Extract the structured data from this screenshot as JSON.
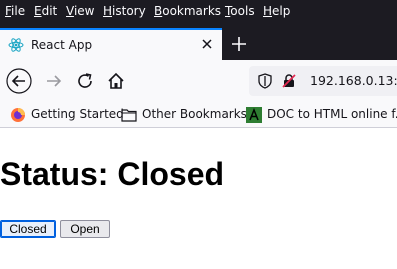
{
  "menu": [
    "File",
    "Edit",
    "View",
    "History",
    "Bookmarks",
    "Tools",
    "Help"
  ],
  "tab": {
    "title": "React App"
  },
  "url": {
    "text": "192.168.0.13:3"
  },
  "bookmarks": [
    {
      "label": "Getting Started",
      "icon": "firefox-icon"
    },
    {
      "label": "Other Bookmarks",
      "icon": "folder-icon"
    },
    {
      "label": "DOC to HTML online f...",
      "icon": "doc-to-html-icon"
    }
  ],
  "page": {
    "heading": "Status: Closed",
    "buttons": [
      "Closed",
      "Open"
    ]
  },
  "colors": {
    "menubar": "#1c1b22",
    "accent": "#0a84ff",
    "toolbar": "#f9f9fb"
  }
}
